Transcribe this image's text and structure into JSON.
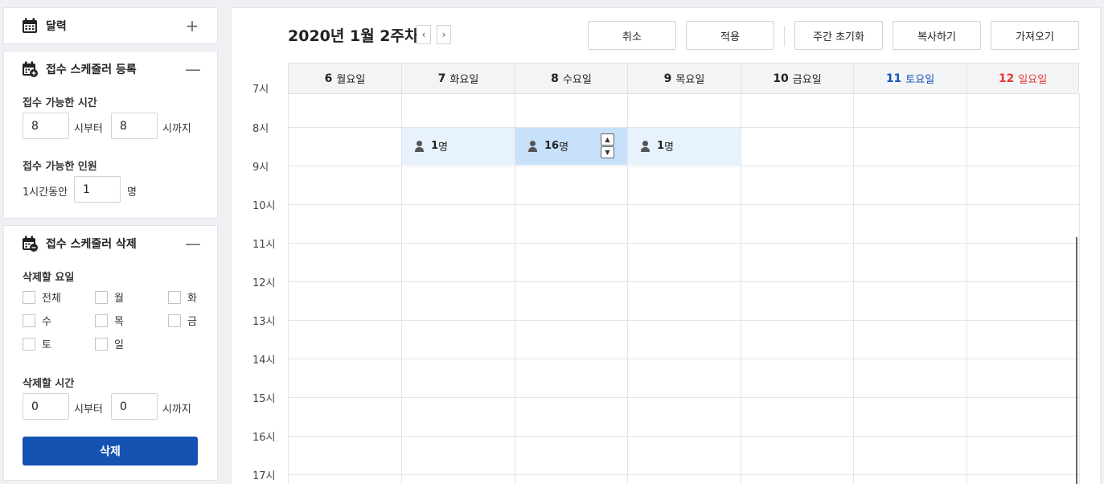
{
  "sidebar": {
    "calendar_panel": {
      "title": "달력",
      "toggle": "+"
    },
    "register_panel": {
      "title": "접수 스케줄러 등록",
      "toggle": "—",
      "time_label": "접수 가능한 시간",
      "from_value": "8",
      "from_suffix": "시부터",
      "to_value": "8",
      "to_suffix": "시까지",
      "people_label": "접수 가능한 인원",
      "per_hour_prefix": "1시간동안",
      "people_value": "1",
      "people_suffix": "명"
    },
    "delete_panel": {
      "title": "접수 스케줄러 삭제",
      "toggle": "—",
      "days_label": "삭제할 요일",
      "days": [
        "전체",
        "월",
        "화",
        "수",
        "목",
        "금",
        "토",
        "일"
      ],
      "time_label": "삭제할 시간",
      "from_value": "0",
      "from_suffix": "시부터",
      "to_value": "0",
      "to_suffix": "시까지",
      "delete_button": "삭제"
    }
  },
  "main": {
    "week_title": "2020년 1월 2주차",
    "prev": "‹",
    "next": "›",
    "toolbar": {
      "cancel": "취소",
      "apply": "적용",
      "reset_week": "주간 초기화",
      "copy": "복사하기",
      "import": "가져오기"
    },
    "days": [
      {
        "date": "6",
        "name": "월요일"
      },
      {
        "date": "7",
        "name": "화요일"
      },
      {
        "date": "8",
        "name": "수요일"
      },
      {
        "date": "9",
        "name": "목요일"
      },
      {
        "date": "10",
        "name": "금요일"
      },
      {
        "date": "11",
        "name": "토요일"
      },
      {
        "date": "12",
        "name": "일요일"
      }
    ],
    "hours": [
      "7시",
      "8시",
      "9시",
      "10시",
      "11시",
      "12시",
      "13시",
      "14시",
      "15시",
      "16시",
      "17시"
    ],
    "slots": [
      {
        "day": "7",
        "hour": "8시",
        "count": "1",
        "unit": "명"
      },
      {
        "day": "8",
        "hour": "8시",
        "count": "16",
        "unit": "명"
      },
      {
        "day": "9",
        "hour": "8시",
        "count": "1",
        "unit": "명"
      }
    ],
    "spin_up": "▲",
    "spin_down": "▼",
    "colors": {
      "primary": "#1553b3",
      "saturday": "#1553b3",
      "sunday": "#e53935",
      "slot": "#e7f2fd",
      "slot_selected": "#c8e1fa"
    }
  }
}
